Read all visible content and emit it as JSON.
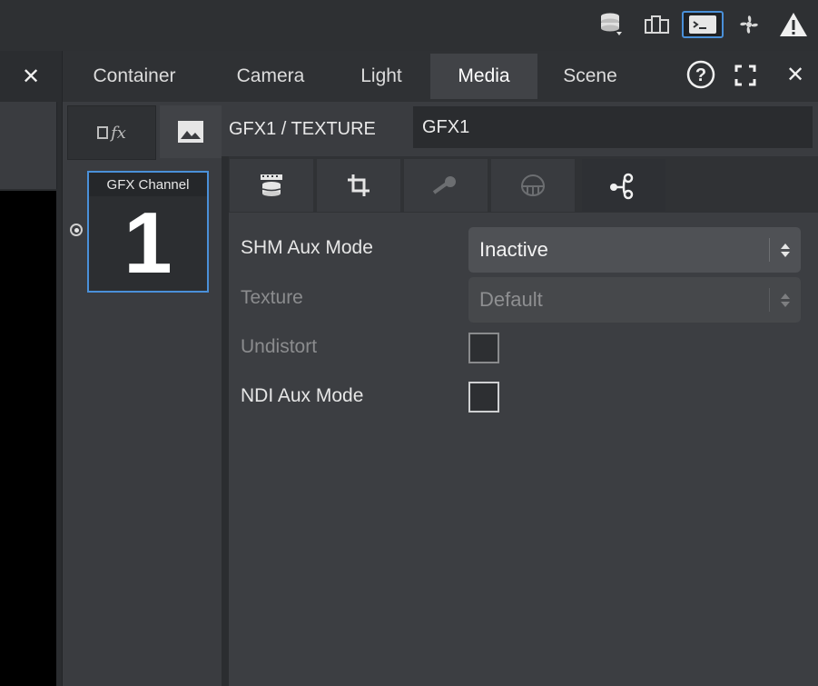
{
  "topbar": {
    "icons": [
      "database-icon",
      "rack-icon",
      "terminal-icon",
      "fan-icon",
      "warning-icon"
    ]
  },
  "tabs": [
    {
      "label": "Container",
      "active": false
    },
    {
      "label": "Camera",
      "active": false
    },
    {
      "label": "Light",
      "active": false
    },
    {
      "label": "Media",
      "active": true
    },
    {
      "label": "Scene",
      "active": false
    }
  ],
  "tab_actions": [
    "help-icon",
    "maximize-icon",
    "close-icon"
  ],
  "subtabs": {
    "fx_label": "fx",
    "path": "GFX1 / TEXTURE",
    "name_value": "GFX1"
  },
  "channel": {
    "title": "GFX Channel",
    "number": "1",
    "selected": true
  },
  "icon_tabs": [
    {
      "icon": "film-stack-icon",
      "active": false,
      "enabled": true
    },
    {
      "icon": "crop-icon",
      "active": false,
      "enabled": true
    },
    {
      "icon": "key-icon",
      "active": false,
      "enabled": false
    },
    {
      "icon": "dome-icon",
      "active": false,
      "enabled": false
    },
    {
      "icon": "share-nodes-icon",
      "active": true,
      "enabled": true
    }
  ],
  "fields": {
    "shm_aux_mode": {
      "label": "SHM Aux Mode",
      "value": "Inactive"
    },
    "texture": {
      "label": "Texture",
      "value": "Default"
    },
    "undistort": {
      "label": "Undistort",
      "checked": false
    },
    "ndi_aux_mode": {
      "label": "NDI Aux Mode",
      "checked": false
    }
  },
  "colors": {
    "accent": "#4a90d9",
    "background": "#3a3c40"
  }
}
